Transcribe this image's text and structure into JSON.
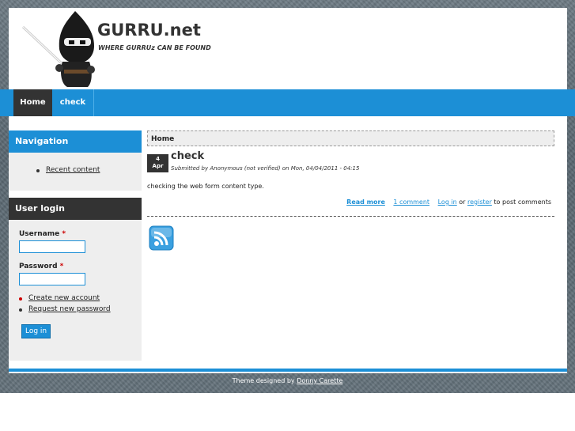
{
  "site": {
    "name": "GURRU.net",
    "slogan": "WHERE GURRUz CAN BE FOUND"
  },
  "nav": {
    "items": [
      {
        "label": "Home"
      },
      {
        "label": "check"
      }
    ]
  },
  "sidebar": {
    "navigation": {
      "title": "Navigation",
      "items": [
        {
          "label": "Recent content"
        }
      ]
    },
    "login": {
      "title": "User login",
      "username_label": "Username",
      "password_label": "Password",
      "required_mark": "*",
      "links": [
        {
          "label": "Create new account"
        },
        {
          "label": "Request new password"
        }
      ],
      "button": "Log in"
    }
  },
  "content": {
    "breadcrumb": "Home",
    "node": {
      "day": "4",
      "month": "Apr",
      "title": "check",
      "submitted": "Submitted by Anonymous (not verified) on Mon, 04/04/2011 - 04:15",
      "body": "checking the web form content type.",
      "links": {
        "read_more": "Read more",
        "comments": "1 comment",
        "login": "Log in",
        "or": "or",
        "register": "register",
        "suffix": "to post comments"
      }
    }
  },
  "footer": {
    "prefix": "Theme designed by",
    "author": "Donny Carette"
  },
  "colors": {
    "accent": "#1c8fd6",
    "dark": "#333333",
    "block_bg": "#eeeeee"
  }
}
